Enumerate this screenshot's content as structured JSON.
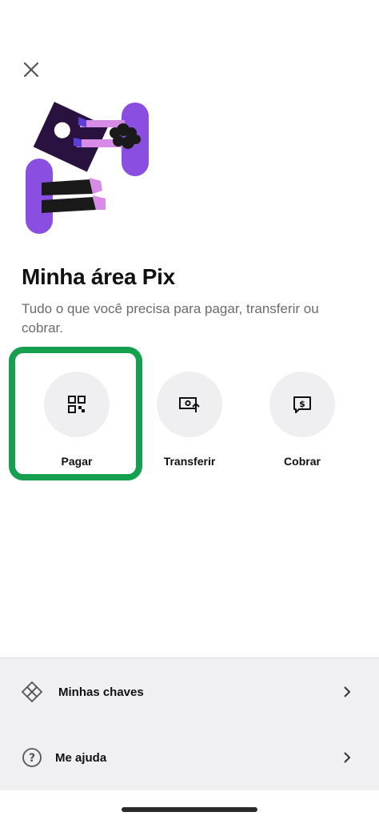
{
  "header": {
    "close_icon": "close-icon"
  },
  "hero": {
    "illustration": "pix-illustration",
    "colors": {
      "purple": "#8a4fe0",
      "dark": "#2a1240",
      "pink": "#d78be6",
      "black": "#1a1a1a"
    }
  },
  "main": {
    "title": "Minha área Pix",
    "subtitle": "Tudo o que você precisa para pagar, transferir ou cobrar."
  },
  "actions": [
    {
      "label": "Pagar",
      "icon": "qr-code-icon"
    },
    {
      "label": "Transferir",
      "icon": "transfer-icon"
    },
    {
      "label": "Cobrar",
      "icon": "charge-icon"
    }
  ],
  "highlight_color": "#15a050",
  "footer": {
    "items": [
      {
        "label": "Minhas chaves",
        "icon": "pix-keys-icon"
      },
      {
        "label": "Me ajuda",
        "icon": "help-icon"
      }
    ]
  }
}
